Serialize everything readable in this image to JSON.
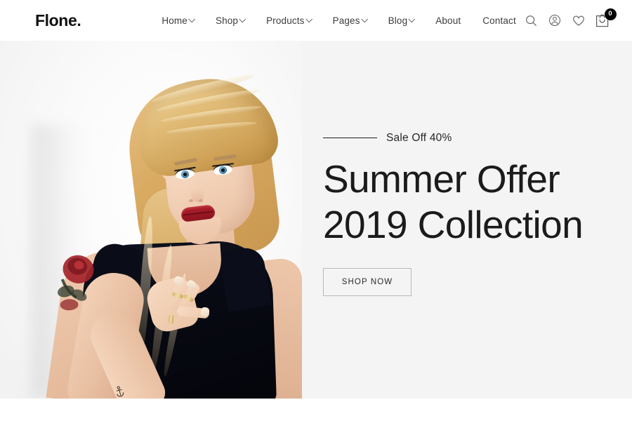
{
  "header": {
    "logo": "Flone.",
    "nav": [
      {
        "label": "Home",
        "has_dropdown": true
      },
      {
        "label": "Shop",
        "has_dropdown": true
      },
      {
        "label": "Products",
        "has_dropdown": true
      },
      {
        "label": "Pages",
        "has_dropdown": true
      },
      {
        "label": "Blog",
        "has_dropdown": true
      },
      {
        "label": "About",
        "has_dropdown": false
      },
      {
        "label": "Contact",
        "has_dropdown": false
      }
    ],
    "icons": {
      "search": "search-icon",
      "account": "user-account-icon",
      "wishlist": "heart-wishlist-icon",
      "cart": "shopping-bag-cart-icon"
    },
    "cart_count": "0"
  },
  "hero": {
    "eyebrow": "Sale Off 40%",
    "title_line1": "Summer Offer",
    "title_line2": "2019 Collection",
    "cta_label": "SHOP NOW",
    "background_color": "#f4f4f4",
    "image_alt": "Blonde model with updo hairstyle, red lipstick and black sleeveless top making a peace sign, rose tattoo on arm"
  }
}
